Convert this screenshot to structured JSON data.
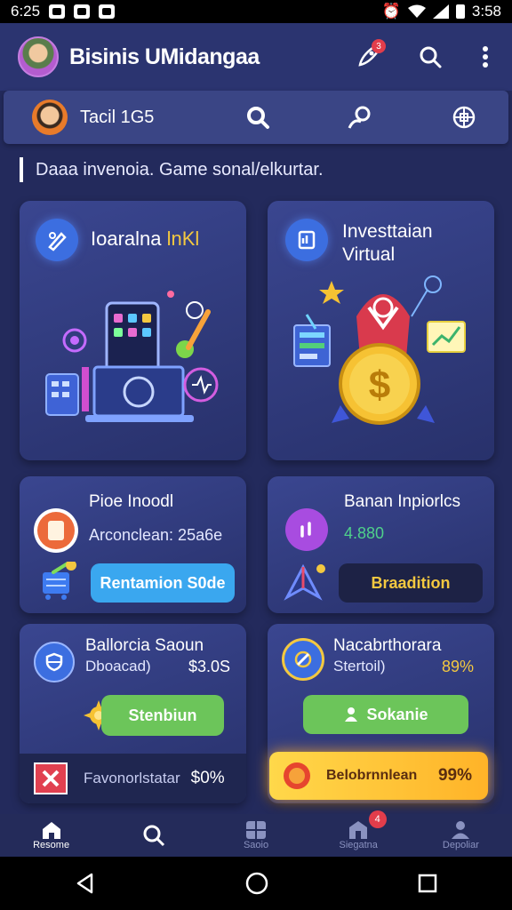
{
  "status_bar": {
    "time": "6:25",
    "clock_right": "3:58"
  },
  "header": {
    "title": "Bisinis UMidangaa",
    "notification_count": "3"
  },
  "profile": {
    "name": "Tacil 1G5"
  },
  "banner": {
    "text": "Daaa invenoia. Game sonal/elkurtar."
  },
  "cards": {
    "card1": {
      "title_white": "Ioaralna ",
      "title_yellow": "lnKl"
    },
    "card2": {
      "title_line1": "Investtaian",
      "title_line2": "Virtual"
    },
    "card3": {
      "title": "Pioe Inoodl",
      "subtitle": "Arconclean: 25a6e",
      "button": "Rentamion S0de"
    },
    "card4": {
      "title": "Banan Inpiorlcs",
      "value": "4.880",
      "button": "Braadition"
    },
    "card5": {
      "title": "Ballorcia Saoun",
      "label": "Dboacad)",
      "value": "$3.0S",
      "button": "Stenbiun",
      "footer_label": "Favonorlstatar",
      "footer_value": "$0%"
    },
    "card6": {
      "title": "Nacabrthorara",
      "label": "Stertoil)",
      "value": "89%",
      "button": "Sokanie",
      "footer_label": "Belobrnnlean",
      "footer_value": "99%"
    }
  },
  "bottom_nav": {
    "items": [
      {
        "label": "Resome",
        "icon": "home-icon"
      },
      {
        "label": "",
        "icon": "search-icon"
      },
      {
        "label": "Saoio",
        "icon": "grid-icon"
      },
      {
        "label": "Siegatna",
        "icon": "store-icon",
        "badge": "4"
      },
      {
        "label": "Depoliar",
        "icon": "user-icon"
      }
    ]
  },
  "colors": {
    "accent_yellow": "#f3c840",
    "accent_green": "#4fd18b",
    "card_bg": "#34408a"
  }
}
